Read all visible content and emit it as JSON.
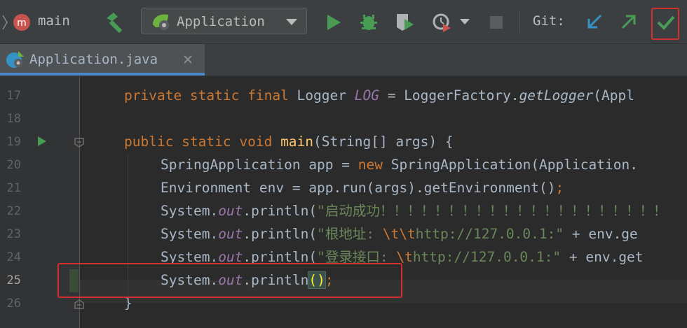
{
  "toolbar": {
    "branch": "main",
    "run_config": "Application",
    "git_label": "Git:"
  },
  "tab": {
    "file_name": "Application.java"
  },
  "editor": {
    "line_numbers": [
      "17",
      "18",
      "19",
      "20",
      "21",
      "22",
      "23",
      "24",
      "25",
      "26"
    ],
    "lines": {
      "l17": {
        "a": "private static final ",
        "b": "Logger ",
        "c": "LOG",
        "d": " = LoggerFactory.",
        "e": "getLogger",
        "f": "(Appl"
      },
      "l19": {
        "a": "public static void ",
        "b": "main",
        "c": "(String[] args) {"
      },
      "l20": {
        "a": "SpringApplication app = ",
        "b": "new ",
        "c": "SpringApplication(Application."
      },
      "l21": {
        "a": "Environment env = app.run(args).getEnvironment()",
        "b": ";"
      },
      "l22": {
        "a": "System.",
        "b": "out",
        "c": ".println(",
        "d": "\"启动成功！！！！！！！！！！！！！！！！！！！！！"
      },
      "l23": {
        "a": "System.",
        "b": "out",
        "c": ".println(",
        "d": "\"根地址: ",
        "e": "\\t\\t",
        "f": "http://127.0.0.1:\"",
        "g": " + env.ge"
      },
      "l24": {
        "a": "System.",
        "b": "out",
        "c": ".println(",
        "d": "\"登录接口: ",
        "e": "\\t",
        "f": "http://127.0.0.1:\"",
        "g": " + env.get"
      },
      "l25": {
        "a": "System.",
        "b": "out",
        "c": ".println",
        "d": "()",
        "e": ";"
      },
      "l26": {
        "a": "}"
      }
    }
  },
  "colors": {
    "accent": "#4a88c7",
    "highlight_box": "#d32f2f",
    "run_green": "#499c54"
  }
}
